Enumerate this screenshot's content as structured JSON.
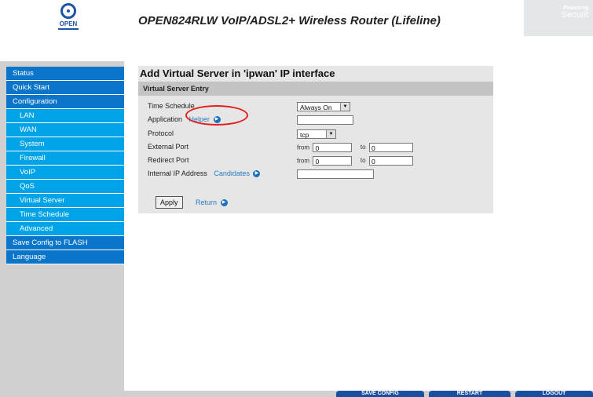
{
  "header": {
    "title": "OPEN824RLW VoIP/ADSL2+ Wireless Router (Lifeline)",
    "logo_text": "OPEN",
    "powering_line1": "Powering",
    "powering_line2": "Securit"
  },
  "sidebar": {
    "items": [
      {
        "label": "Status",
        "level": 0
      },
      {
        "label": "Quick Start",
        "level": 0
      },
      {
        "label": "Configuration",
        "level": 0
      },
      {
        "label": "LAN",
        "level": 1
      },
      {
        "label": "WAN",
        "level": 1
      },
      {
        "label": "System",
        "level": 1
      },
      {
        "label": "Firewall",
        "level": 1
      },
      {
        "label": "VoIP",
        "level": 1
      },
      {
        "label": "QoS",
        "level": 1
      },
      {
        "label": "Virtual Server",
        "level": 1
      },
      {
        "label": "Time Schedule",
        "level": 1
      },
      {
        "label": "Advanced",
        "level": 1
      },
      {
        "label": "Save Config to FLASH",
        "level": 0
      },
      {
        "label": "Language",
        "level": 0
      }
    ]
  },
  "main": {
    "panel_title": "Add Virtual Server in 'ipwan' IP interface",
    "entry_header": "Virtual Server Entry",
    "time_schedule_label": "Time Schedule",
    "time_schedule_value": "Always On",
    "application_label": "Application",
    "helper_link": "Helper",
    "application_value": "",
    "protocol_label": "Protocol",
    "protocol_value": "tcp",
    "external_port_label": "External Port",
    "redirect_port_label": "Redirect Port",
    "from_label": "from",
    "to_label": "to",
    "external_from": "0",
    "external_to": "0",
    "redirect_from": "0",
    "redirect_to": "0",
    "internal_ip_label": "Internal IP Address",
    "candidates_link": "Candidates",
    "internal_ip_value": "",
    "apply_label": "Apply",
    "return_label": "Return"
  },
  "bottom_buttons": {
    "save_config": "SAVE CONFIG",
    "restart": "RESTART",
    "logout": "LOGOUT"
  },
  "colors": {
    "nav_primary": "#0a75c9",
    "nav_sub": "#00a3e8",
    "link": "#2b7cc2",
    "highlight_oval": "#e51d1d"
  }
}
